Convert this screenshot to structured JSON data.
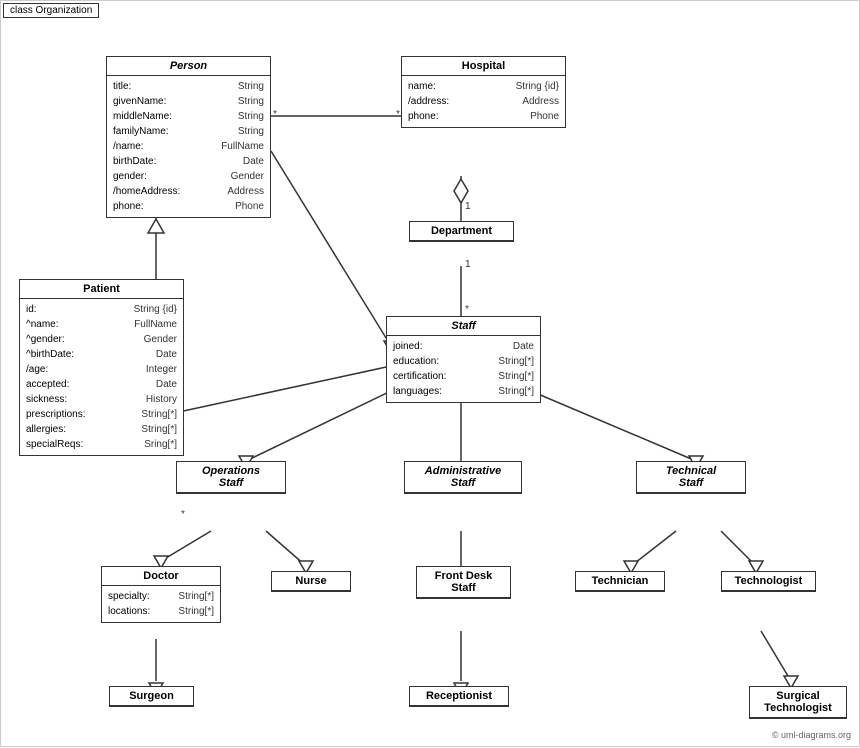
{
  "diagram": {
    "title": "class Organization",
    "classes": {
      "person": {
        "name": "Person",
        "italic": true,
        "attrs": [
          [
            "title:",
            "String"
          ],
          [
            "givenName:",
            "String"
          ],
          [
            "middleName:",
            "String"
          ],
          [
            "familyName:",
            "String"
          ],
          [
            "/name:",
            "FullName"
          ],
          [
            "birthDate:",
            "Date"
          ],
          [
            "gender:",
            "Gender"
          ],
          [
            "/homeAddress:",
            "Address"
          ],
          [
            "phone:",
            "Phone"
          ]
        ]
      },
      "hospital": {
        "name": "Hospital",
        "italic": false,
        "attrs": [
          [
            "name:",
            "String {id}"
          ],
          [
            "/address:",
            "Address"
          ],
          [
            "phone:",
            "Phone"
          ]
        ]
      },
      "patient": {
        "name": "Patient",
        "italic": false,
        "attrs": [
          [
            "id:",
            "String {id}"
          ],
          [
            "^name:",
            "FullName"
          ],
          [
            "^gender:",
            "Gender"
          ],
          [
            "^birthDate:",
            "Date"
          ],
          [
            "/age:",
            "Integer"
          ],
          [
            "accepted:",
            "Date"
          ],
          [
            "sickness:",
            "History"
          ],
          [
            "prescriptions:",
            "String[*]"
          ],
          [
            "allergies:",
            "String[*]"
          ],
          [
            "specialReqs:",
            "Sring[*]"
          ]
        ]
      },
      "department": {
        "name": "Department",
        "italic": false,
        "attrs": []
      },
      "staff": {
        "name": "Staff",
        "italic": true,
        "attrs": [
          [
            "joined:",
            "Date"
          ],
          [
            "education:",
            "String[*]"
          ],
          [
            "certification:",
            "String[*]"
          ],
          [
            "languages:",
            "String[*]"
          ]
        ]
      },
      "operations_staff": {
        "name": "Operations Staff",
        "italic": true,
        "attrs": []
      },
      "administrative_staff": {
        "name": "Administrative Staff",
        "italic": true,
        "attrs": []
      },
      "technical_staff": {
        "name": "Technical Staff",
        "italic": true,
        "attrs": []
      },
      "doctor": {
        "name": "Doctor",
        "italic": false,
        "attrs": [
          [
            "specialty:",
            "String[*]"
          ],
          [
            "locations:",
            "String[*]"
          ]
        ]
      },
      "nurse": {
        "name": "Nurse",
        "italic": false,
        "attrs": []
      },
      "front_desk_staff": {
        "name": "Front Desk Staff",
        "italic": false,
        "attrs": []
      },
      "technician": {
        "name": "Technician",
        "italic": false,
        "attrs": []
      },
      "technologist": {
        "name": "Technologist",
        "italic": false,
        "attrs": []
      },
      "surgeon": {
        "name": "Surgeon",
        "italic": false,
        "attrs": []
      },
      "receptionist": {
        "name": "Receptionist",
        "italic": false,
        "attrs": []
      },
      "surgical_technologist": {
        "name": "Surgical Technologist",
        "italic": false,
        "attrs": []
      }
    },
    "copyright": "© uml-diagrams.org"
  }
}
